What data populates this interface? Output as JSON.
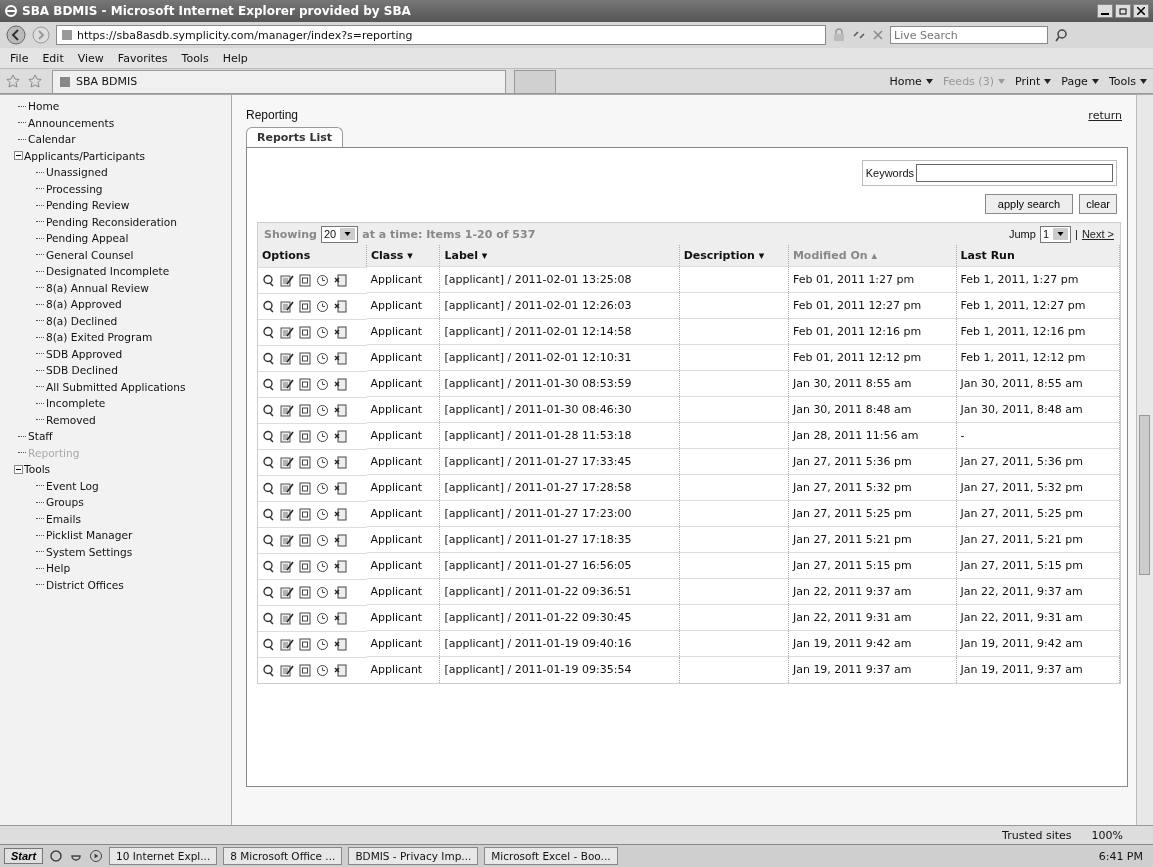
{
  "window": {
    "title": "SBA BDMIS - Microsoft Internet Explorer provided by SBA"
  },
  "address_bar": {
    "url": "https://sba8asdb.symplicity.com/manager/index?s=reporting",
    "search_placeholder": "Live Search"
  },
  "menu": [
    "File",
    "Edit",
    "View",
    "Favorites",
    "Tools",
    "Help"
  ],
  "favorites_tab": "SBA BDMIS",
  "command_bar": [
    {
      "label": "Home",
      "disabled": false
    },
    {
      "label": "Feeds (3)",
      "disabled": true
    },
    {
      "label": "Print",
      "disabled": false
    },
    {
      "label": "Page",
      "disabled": false
    },
    {
      "label": "Tools",
      "disabled": false
    }
  ],
  "sidebar": {
    "items": [
      {
        "label": "Home",
        "selected": false
      },
      {
        "label": "Announcements",
        "selected": false
      },
      {
        "label": "Calendar",
        "selected": false
      },
      {
        "label": "Applicants/Participants",
        "selected": false,
        "expanded": true,
        "children": [
          {
            "label": "Unassigned",
            "selected": false
          },
          {
            "label": "Processing",
            "selected": false
          },
          {
            "label": "Pending Review",
            "selected": false
          },
          {
            "label": "Pending Reconsideration",
            "selected": false
          },
          {
            "label": "Pending Appeal",
            "selected": false
          },
          {
            "label": "General Counsel",
            "selected": false
          },
          {
            "label": "Designated Incomplete",
            "selected": false
          },
          {
            "label": "8(a) Annual Review",
            "selected": false
          },
          {
            "label": "8(a) Approved",
            "selected": false
          },
          {
            "label": "8(a) Declined",
            "selected": false
          },
          {
            "label": "8(a) Exited Program",
            "selected": false
          },
          {
            "label": "SDB Approved",
            "selected": false
          },
          {
            "label": "SDB Declined",
            "selected": false
          },
          {
            "label": "All Submitted Applications",
            "selected": false
          },
          {
            "label": "Incomplete",
            "selected": false
          },
          {
            "label": "Removed",
            "selected": false
          }
        ]
      },
      {
        "label": "Staff",
        "selected": false
      },
      {
        "label": "Reporting",
        "selected": true
      },
      {
        "label": "Tools",
        "selected": false,
        "expanded": true,
        "children": [
          {
            "label": "Event Log",
            "selected": false
          },
          {
            "label": "Groups",
            "selected": false
          },
          {
            "label": "Emails",
            "selected": false
          },
          {
            "label": "Picklist Manager",
            "selected": false
          },
          {
            "label": "System Settings",
            "selected": false
          },
          {
            "label": "Help",
            "selected": false
          },
          {
            "label": "District Offices",
            "selected": false
          }
        ]
      }
    ]
  },
  "main": {
    "heading": "Reporting",
    "return_link": "return",
    "tabs": [
      {
        "label": "Reports List",
        "selected": true
      }
    ],
    "search": {
      "label": "Keywords",
      "buttons": [
        "apply search",
        "clear"
      ]
    },
    "pager": {
      "showing": "Showing",
      "per_page": "20",
      "summary": "at a time: Items 1-20 of 537",
      "jump": "Jump",
      "page": "1",
      "separator": "|",
      "next": "Next >"
    },
    "table": {
      "columns": [
        {
          "label": "Options",
          "sorted": false
        },
        {
          "label": "Class ▾",
          "sorted": false
        },
        {
          "label": "Label ▾",
          "sorted": false
        },
        {
          "label": "Description ▾",
          "sorted": false
        },
        {
          "label": "Modified On ▴",
          "sorted": true
        },
        {
          "label": "Last Run",
          "sorted": false
        }
      ],
      "rows": [
        {
          "class": "Applicant",
          "label": "[applicant] / 2011-02-01 13:25:08",
          "modified": "Feb 01, 2011 1:27 pm",
          "last_run": "Feb 1, 2011, 1:27 pm"
        },
        {
          "class": "Applicant",
          "label": "[applicant] / 2011-02-01 12:26:03",
          "modified": "Feb 01, 2011 12:27 pm",
          "last_run": "Feb 1, 2011, 12:27 pm"
        },
        {
          "class": "Applicant",
          "label": "[applicant] / 2011-02-01 12:14:58",
          "modified": "Feb 01, 2011 12:16 pm",
          "last_run": "Feb 1, 2011, 12:16 pm"
        },
        {
          "class": "Applicant",
          "label": "[applicant] / 2011-02-01 12:10:31",
          "modified": "Feb 01, 2011 12:12 pm",
          "last_run": "Feb 1, 2011, 12:12 pm"
        },
        {
          "class": "Applicant",
          "label": "[applicant] / 2011-01-30 08:53:59",
          "modified": "Jan 30, 2011 8:55 am",
          "last_run": "Jan 30, 2011, 8:55 am"
        },
        {
          "class": "Applicant",
          "label": "[applicant] / 2011-01-30 08:46:30",
          "modified": "Jan 30, 2011 8:48 am",
          "last_run": "Jan 30, 2011, 8:48 am"
        },
        {
          "class": "Applicant",
          "label": "[applicant] / 2011-01-28 11:53:18",
          "modified": "Jan 28, 2011 11:56 am",
          "last_run": "-"
        },
        {
          "class": "Applicant",
          "label": "[applicant] / 2011-01-27 17:33:45",
          "modified": "Jan 27, 2011 5:36 pm",
          "last_run": "Jan 27, 2011, 5:36 pm"
        },
        {
          "class": "Applicant",
          "label": "[applicant] / 2011-01-27 17:28:58",
          "modified": "Jan 27, 2011 5:32 pm",
          "last_run": "Jan 27, 2011, 5:32 pm"
        },
        {
          "class": "Applicant",
          "label": "[applicant] / 2011-01-27 17:23:00",
          "modified": "Jan 27, 2011 5:25 pm",
          "last_run": "Jan 27, 2011, 5:25 pm"
        },
        {
          "class": "Applicant",
          "label": "[applicant] / 2011-01-27 17:18:35",
          "modified": "Jan 27, 2011 5:21 pm",
          "last_run": "Jan 27, 2011, 5:21 pm"
        },
        {
          "class": "Applicant",
          "label": "[applicant] / 2011-01-27 16:56:05",
          "modified": "Jan 27, 2011 5:15 pm",
          "last_run": "Jan 27, 2011, 5:15 pm"
        },
        {
          "class": "Applicant",
          "label": "[applicant] / 2011-01-22 09:36:51",
          "modified": "Jan 22, 2011 9:37 am",
          "last_run": "Jan 22, 2011, 9:37 am"
        },
        {
          "class": "Applicant",
          "label": "[applicant] / 2011-01-22 09:30:45",
          "modified": "Jan 22, 2011 9:31 am",
          "last_run": "Jan 22, 2011, 9:31 am"
        },
        {
          "class": "Applicant",
          "label": "[applicant] / 2011-01-19 09:40:16",
          "modified": "Jan 19, 2011 9:42 am",
          "last_run": "Jan 19, 2011, 9:42 am"
        },
        {
          "class": "Applicant",
          "label": "[applicant] / 2011-01-19 09:35:54",
          "modified": "Jan 19, 2011 9:37 am",
          "last_run": "Jan 19, 2011, 9:37 am"
        }
      ]
    }
  },
  "status_bar": {
    "zone": "Trusted sites",
    "zoom": "100%"
  },
  "taskbar": {
    "start": "Start",
    "tasks": [
      "10 Internet Expl...",
      "8 Microsoft Office ...",
      "BDMIS - Privacy Imp...",
      "Microsoft Excel - Boo..."
    ],
    "clock": "6:41 PM"
  }
}
